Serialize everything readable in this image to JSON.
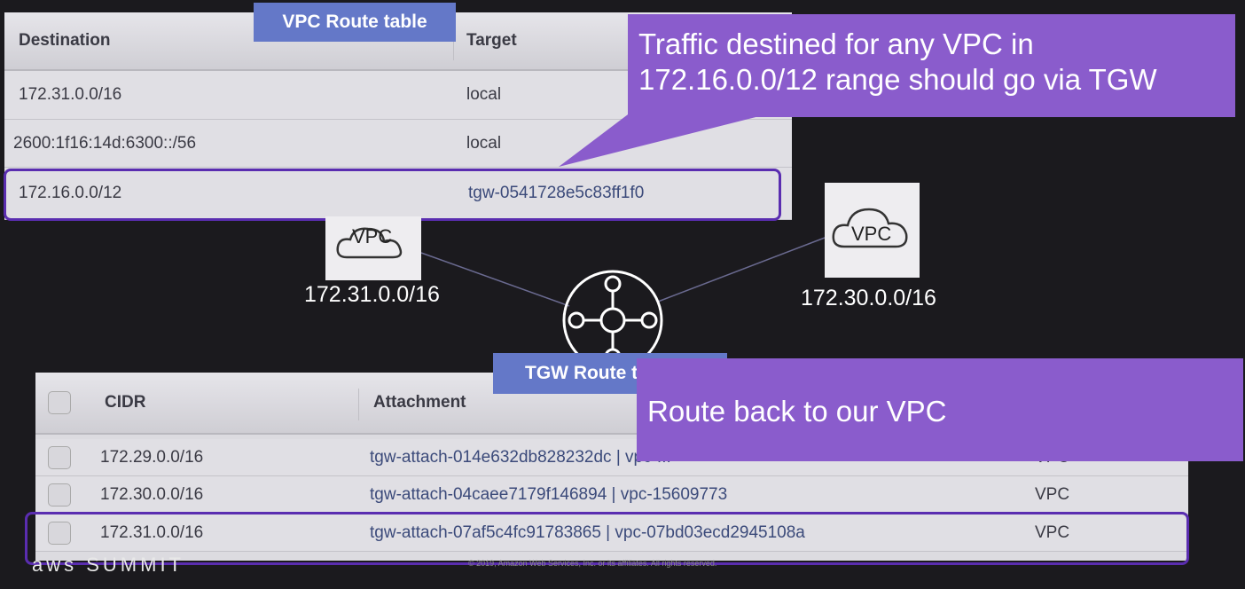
{
  "vpc_route_table": {
    "label": "VPC Route table",
    "headers": {
      "destination": "Destination",
      "target": "Target"
    },
    "rows": [
      {
        "destination": "172.31.0.0/16",
        "target": "local"
      },
      {
        "destination": "2600:1f16:14d:6300::/56",
        "target": "local"
      },
      {
        "destination": "172.16.0.0/12",
        "target": "tgw-0541728e5c83ff1f0"
      }
    ]
  },
  "callout_top": {
    "line1": "Traffic destined for any VPC in",
    "line2": "172.16.0.0/12 range should go via TGW"
  },
  "diagram": {
    "vpc_left": {
      "icon_text": "VPC",
      "cidr": "172.31.0.0/16"
    },
    "vpc_right": {
      "icon_text": "VPC",
      "cidr": "172.30.0.0/16"
    }
  },
  "tgw_route_table": {
    "label": "TGW Route table",
    "headers": {
      "cidr": "CIDR",
      "attachment": "Attachment"
    },
    "rows": [
      {
        "cidr": "172.29.0.0/16",
        "attachment": "tgw-attach-014e632db828232dc | vpc-...",
        "type": "VPC"
      },
      {
        "cidr": "172.30.0.0/16",
        "attachment": "tgw-attach-04caee7179f146894 | vpc-15609773",
        "type": "VPC"
      },
      {
        "cidr": "172.31.0.0/16",
        "attachment": "tgw-attach-07af5c4fc91783865 | vpc-07bd03ecd2945108a",
        "type": "VPC"
      }
    ]
  },
  "callout_bottom": {
    "text": "Route back to our VPC"
  },
  "footer": {
    "logo": "aws SUMMIT",
    "copyright": "© 2019, Amazon Web Services, Inc. or its affiliates. All rights reserved."
  }
}
